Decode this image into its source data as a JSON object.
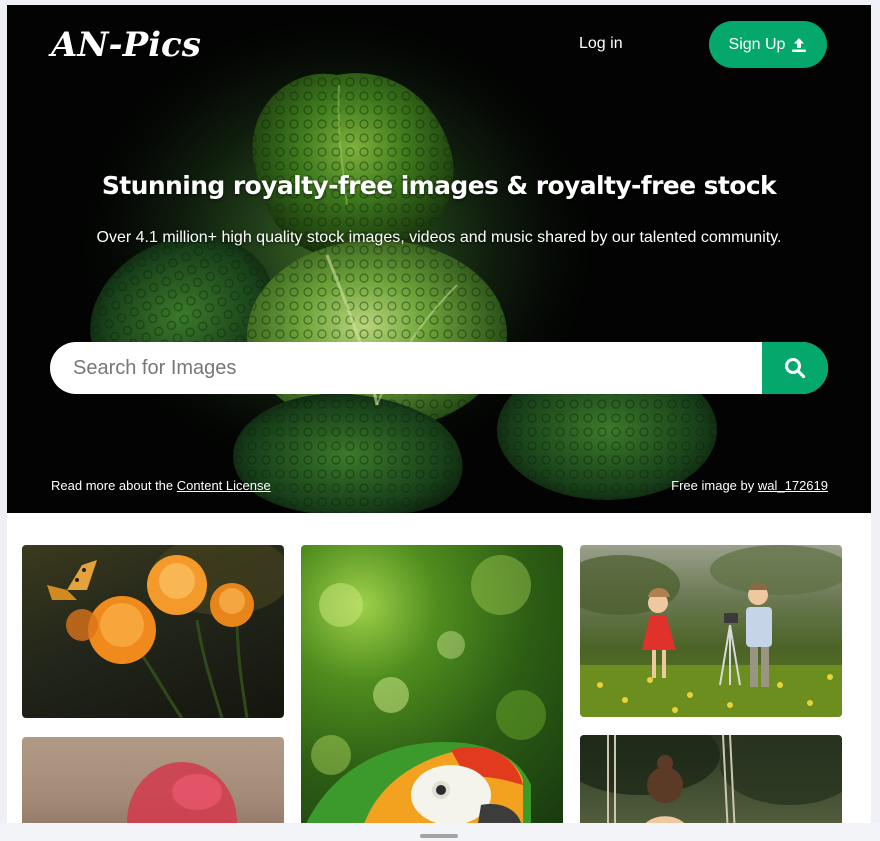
{
  "brand": {
    "logo": "AN-Pics"
  },
  "nav": {
    "login_label": "Log in",
    "signup_label": "Sign Up",
    "signup_icon": "upload-icon"
  },
  "hero": {
    "title": "Stunning royalty-free images & royalty-free stock",
    "subtitle": "Over 4.1 million+ high quality stock images, videos and music shared by our talented community.",
    "search": {
      "placeholder": "Search for Images",
      "value": "",
      "button_icon": "search-icon"
    },
    "license_prefix": "Read more about the",
    "license_link": "Content License",
    "credit_prefix": "Free image by",
    "credit_user": "wal_172619"
  },
  "gallery": {
    "images": [
      {
        "subject": "orange flowers with butterfly"
      },
      {
        "subject": "parrot on green bokeh"
      },
      {
        "subject": "children with camera in field"
      },
      {
        "subject": "blurred red object"
      },
      {
        "subject": "girl on swing"
      }
    ]
  },
  "colors": {
    "accent": "#05a86c",
    "hero_bg": "#050805",
    "page_bg": "#eef0f6"
  }
}
